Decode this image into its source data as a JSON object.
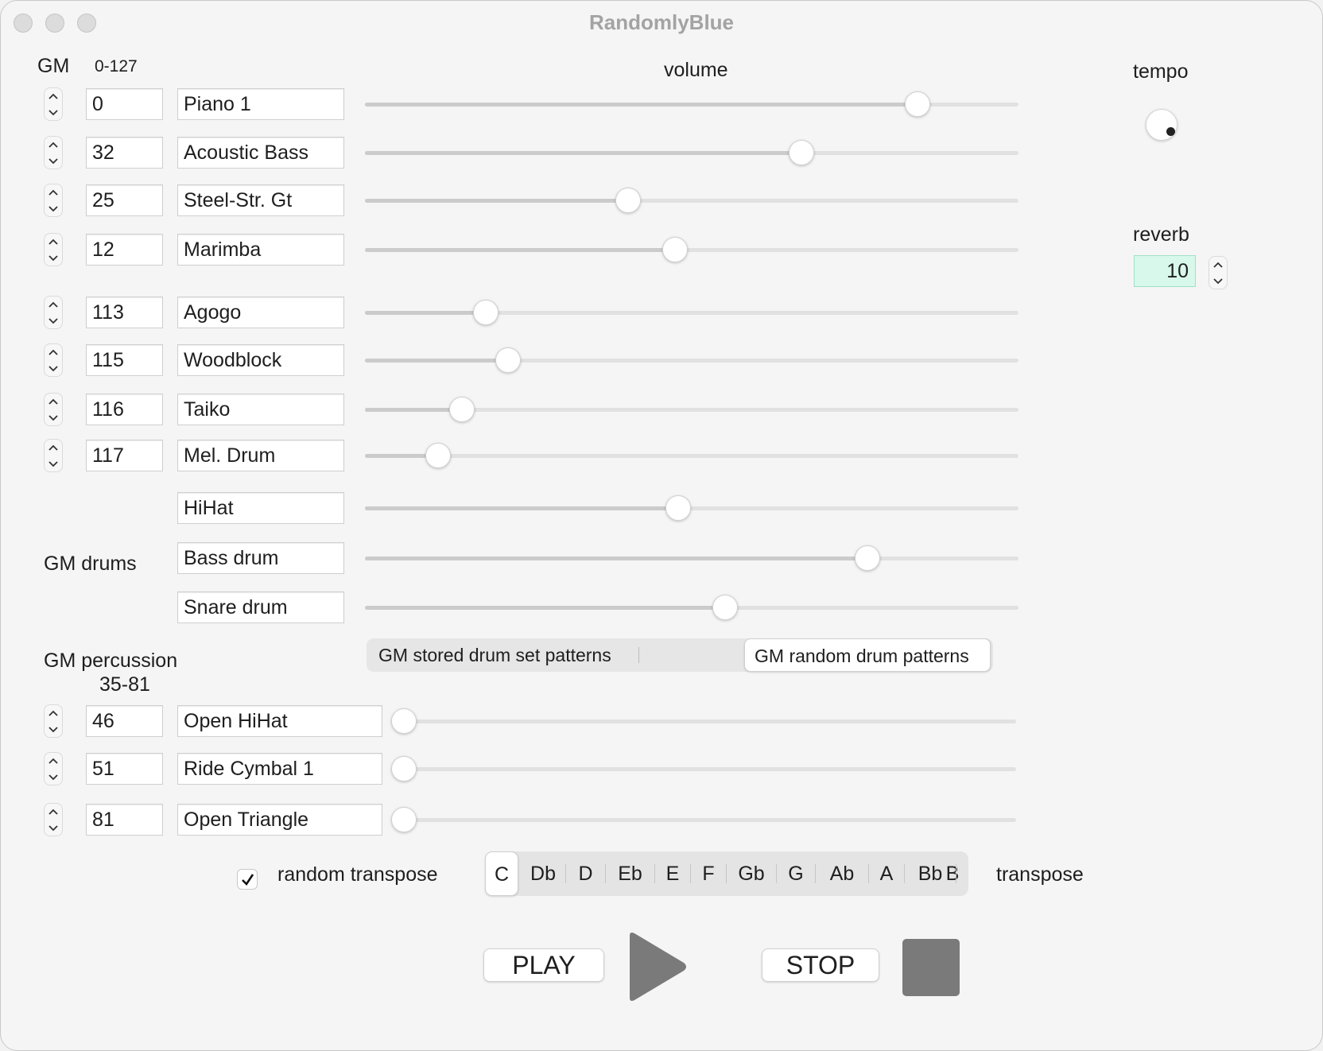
{
  "window": {
    "title": "RandomlyBlue"
  },
  "headers": {
    "gm": "GM",
    "range": "0-127",
    "volume": "volume",
    "tempo": "tempo",
    "reverb": "reverb"
  },
  "instruments": [
    {
      "program": "0",
      "name": "Piano 1",
      "volume": 0.86
    },
    {
      "program": "32",
      "name": "Acoustic Bass",
      "volume": 0.675
    },
    {
      "program": "25",
      "name": "Steel-Str. Gt",
      "volume": 0.399
    },
    {
      "program": "12",
      "name": "Marimba",
      "volume": 0.474
    },
    {
      "program": "113",
      "name": "Agogo",
      "volume": 0.172
    },
    {
      "program": "115",
      "name": "Woodblock",
      "volume": 0.208
    },
    {
      "program": "116",
      "name": "Taiko",
      "volume": 0.134
    },
    {
      "program": "117",
      "name": "Mel. Drum",
      "volume": 0.096
    }
  ],
  "drums": {
    "label": "GM drums",
    "items": [
      {
        "name": "HiHat",
        "volume": 0.478
      },
      {
        "name": "Bass drum",
        "volume": 0.78
      },
      {
        "name": "Snare drum",
        "volume": 0.553
      }
    ]
  },
  "drum_patterns": {
    "options": [
      "GM stored drum set patterns",
      "GM random drum patterns"
    ],
    "selected": "GM random drum patterns"
  },
  "percussion": {
    "label": "GM percussion",
    "range": "35-81",
    "items": [
      {
        "program": "46",
        "name": "Open HiHat",
        "volume": 0.0
      },
      {
        "program": "51",
        "name": "Ride Cymbal 1",
        "volume": 0.0
      },
      {
        "program": "81",
        "name": "Open Triangle",
        "volume": 0.0
      }
    ]
  },
  "tempo": {
    "value": ""
  },
  "reverb": {
    "value": "10"
  },
  "transpose": {
    "random_label": "random transpose",
    "random_checked": true,
    "keys": [
      "C",
      "Db",
      "D",
      "Eb",
      "E",
      "F",
      "Gb",
      "G",
      "Ab",
      "A",
      "Bb",
      "B"
    ],
    "selected": "C",
    "label": "transpose"
  },
  "controls": {
    "play_label": "PLAY",
    "stop_label": "STOP"
  },
  "icons": {
    "stepper_up": "chevron-up-icon",
    "stepper_down": "chevron-down-icon",
    "checkmark": "checkmark-icon",
    "play": "play-icon",
    "stop": "stop-icon"
  },
  "colors": {
    "reverb_field_bg": "#d8f8ec",
    "icon_gray": "#7a7a7a"
  }
}
